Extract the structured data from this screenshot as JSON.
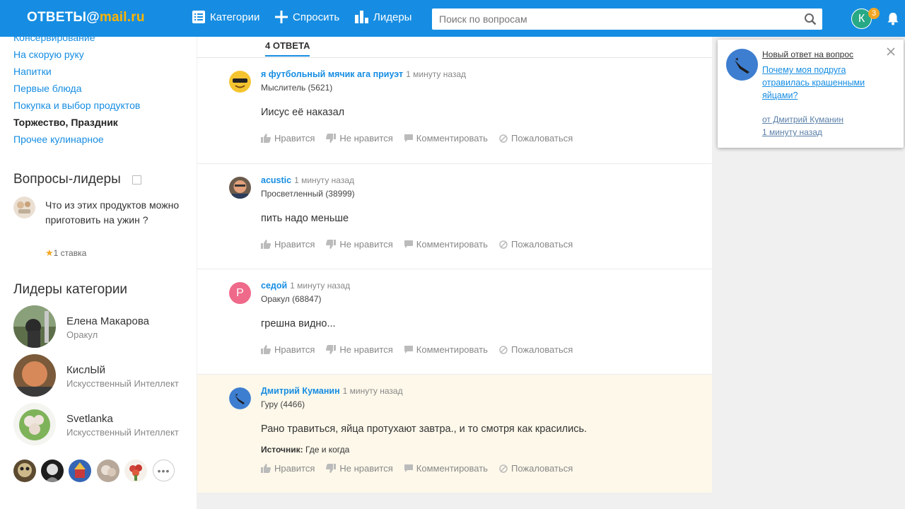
{
  "header": {
    "logo_left": "ОТВЕТЫ@",
    "logo_right": "mail.ru",
    "nav": {
      "categories": "Категории",
      "ask": "Спросить",
      "leaders": "Лидеры"
    },
    "search_placeholder": "Поиск по вопросам",
    "avatar_letter": "К",
    "notification_count": "3"
  },
  "sidebar": {
    "categories": [
      {
        "label": "Консервирование"
      },
      {
        "label": "На скорую руку"
      },
      {
        "label": "Напитки"
      },
      {
        "label": "Первые блюда"
      },
      {
        "label": "Покупка и выбор продуктов"
      },
      {
        "label": "Торжество, Праздник",
        "active": true
      },
      {
        "label": "Прочее кулинарное"
      }
    ],
    "top_questions_title": "Вопросы-лидеры",
    "top_question": {
      "text": "Что из этих продуктов можно приготовить на ужин ?",
      "stake": "1 ставка"
    },
    "category_leaders_title": "Лидеры категории",
    "leaders": [
      {
        "name": "Елена Макарова",
        "rank": "Оракул"
      },
      {
        "name": "КислЫй",
        "rank": "Искусственный Интеллект"
      },
      {
        "name": "Svetlanka",
        "rank": "Искусственный Интеллект"
      }
    ],
    "more_label": "•••"
  },
  "main": {
    "answers_tab": "4 ОТВЕТА",
    "actions": {
      "like": "Нравится",
      "dislike": "Не нравится",
      "comment": "Комментировать",
      "report": "Пожаловаться"
    },
    "answers": [
      {
        "author": "я футбольный мячик ага приуэт",
        "time": "1 минуту назад",
        "rank": "Мыслитель (5621)",
        "text": "Иисус её наказал"
      },
      {
        "author": "acustic",
        "time": "1 минуту назад",
        "rank": "Просветленный (38999)",
        "text": "пить надо меньше"
      },
      {
        "author": "седой",
        "time": "1 минуту назад",
        "rank": "Оракул (68847)",
        "text": "грешна видно...",
        "avatar_letter": "Р"
      },
      {
        "author": "Дмитрий Куманин",
        "time": "1 минуту назад",
        "rank": "Гуру (4466)",
        "text": "Рано травиться, яйца протухают завтра., и то смотря как красились.",
        "source_label": "Источник:",
        "source_value": "Где и когда"
      }
    ]
  },
  "notification": {
    "title": "Новый ответ на вопрос",
    "question": "Почему моя подруга отравилась крашенными яйцами?",
    "from": "от Дмитрий Куманин",
    "time": "1 минуту назад"
  },
  "colors": {
    "brand": "#168de2",
    "accent": "#ffb400",
    "highlight_bg": "#fdf8ea"
  }
}
